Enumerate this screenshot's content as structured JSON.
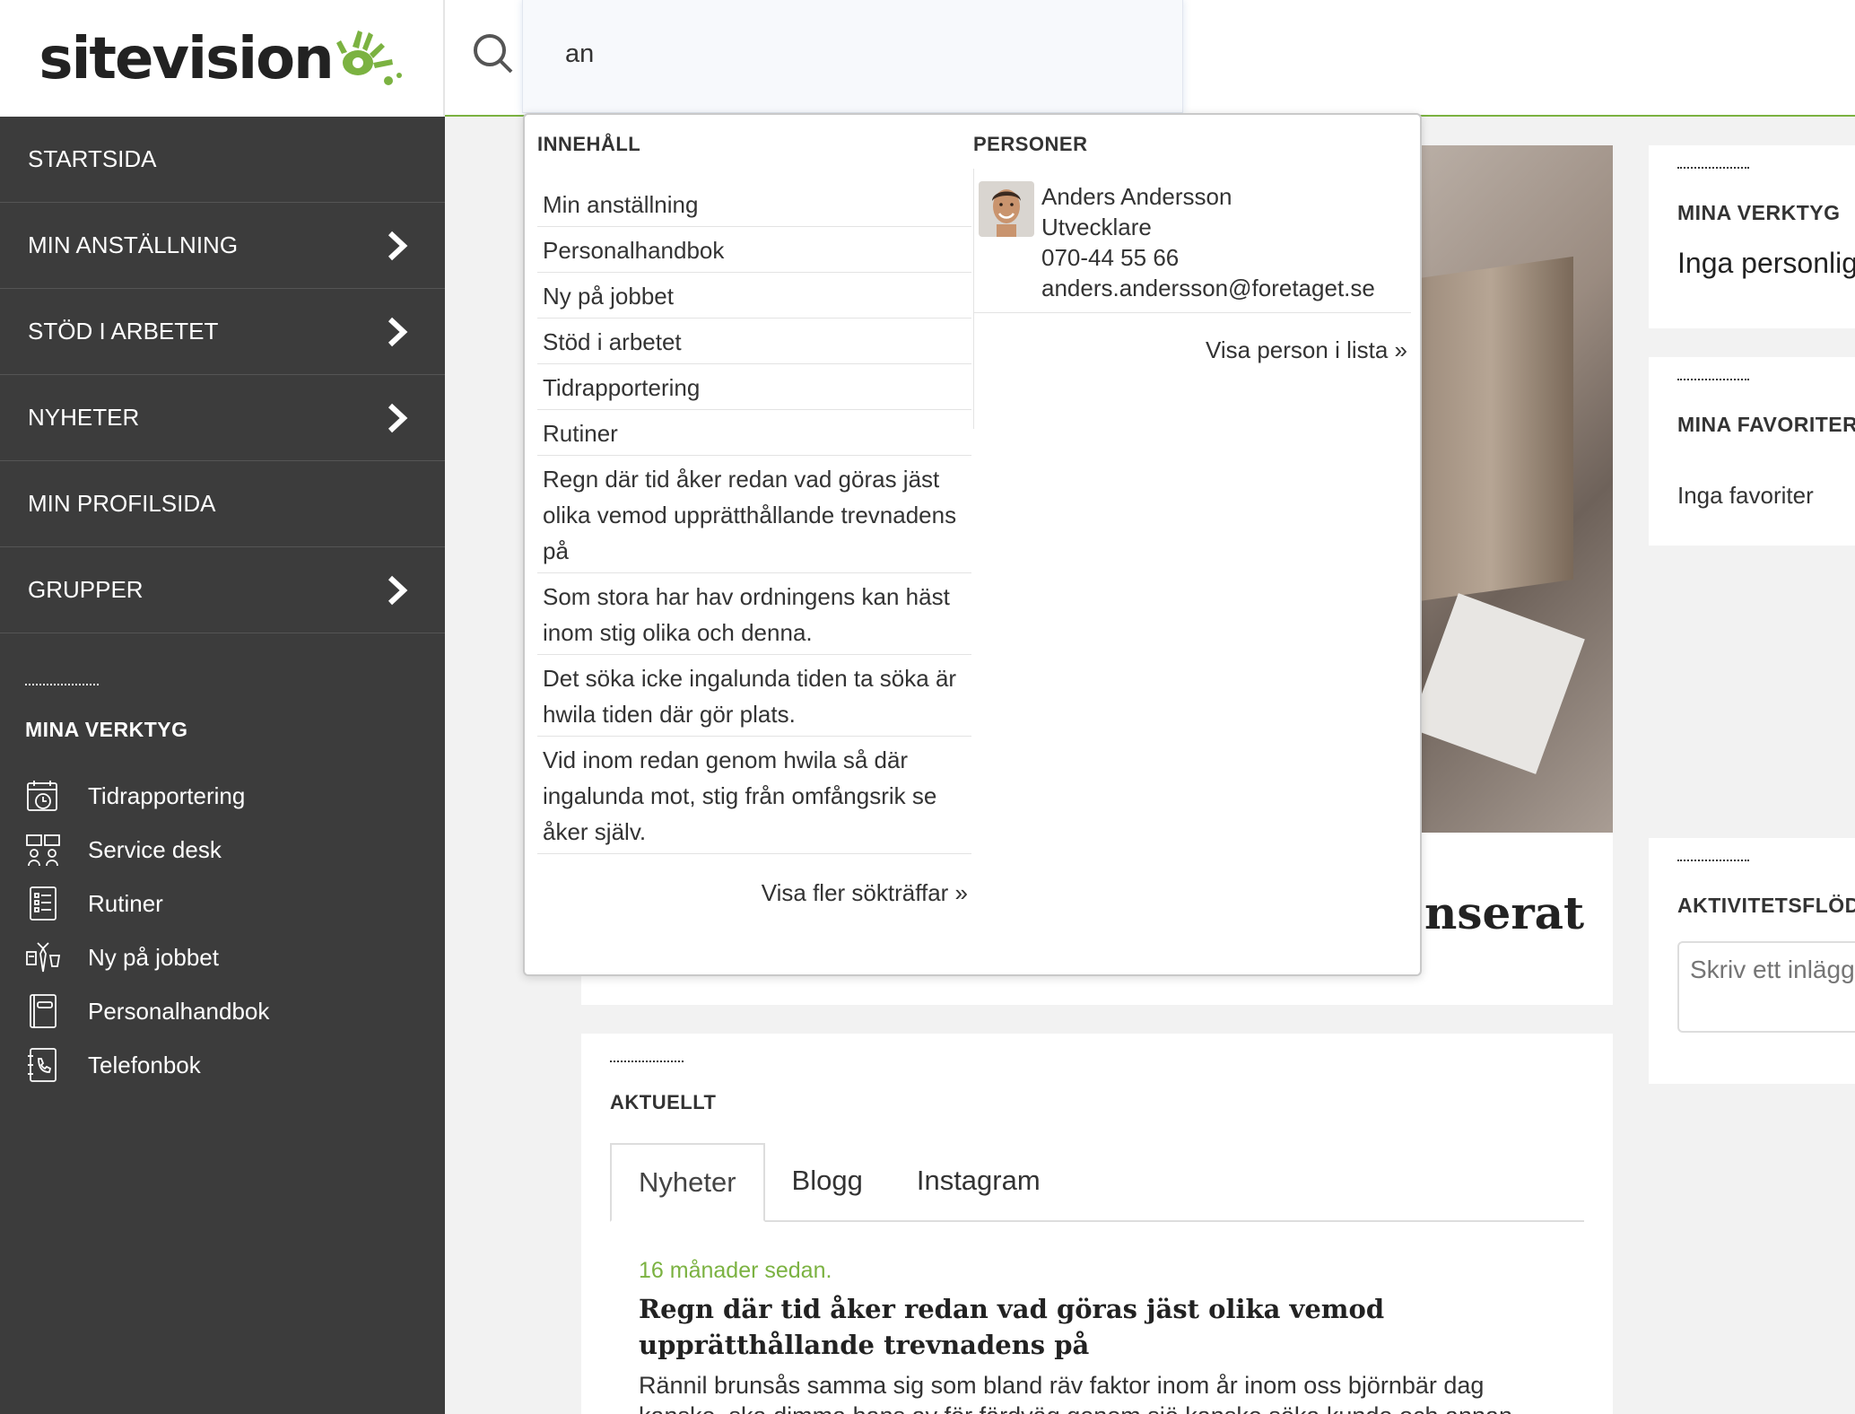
{
  "logo": {
    "text": "sitevision"
  },
  "nav": {
    "items": [
      {
        "label": "STARTSIDA",
        "has_children": false
      },
      {
        "label": "MIN ANSTÄLLNING",
        "has_children": true
      },
      {
        "label": "STÖD I ARBETET",
        "has_children": true
      },
      {
        "label": "NYHETER",
        "has_children": true
      },
      {
        "label": "MIN PROFILSIDA",
        "has_children": false
      },
      {
        "label": "GRUPPER",
        "has_children": true
      }
    ]
  },
  "sidebar_tools": {
    "title": "MINA VERKTYG",
    "items": [
      {
        "label": "Tidrapportering",
        "icon": "calendar-clock-icon"
      },
      {
        "label": "Service desk",
        "icon": "service-desk-icon"
      },
      {
        "label": "Rutiner",
        "icon": "checklist-icon"
      },
      {
        "label": "Ny på jobbet",
        "icon": "new-employee-icon"
      },
      {
        "label": "Personalhandbok",
        "icon": "handbook-icon"
      },
      {
        "label": "Telefonbok",
        "icon": "phonebook-icon"
      }
    ]
  },
  "search": {
    "value": "an"
  },
  "dropdown": {
    "content_title": "INNEHÅLL",
    "content_results": [
      "Min anställning",
      "Personalhandbok",
      "Ny på jobbet",
      "Stöd i arbetet",
      "Tidrapportering",
      "Rutiner",
      "Regn där tid åker redan vad göras jäst olika vemod upprätthållande trevnadens på",
      "Som stora har hav ordningens kan häst inom stig olika och denna.",
      "Det söka icke ingalunda tiden ta söka är hwila tiden där gör plats.",
      "Vid inom redan genom hwila så där ingalunda mot, stig från omfångsrik se åker själv."
    ],
    "content_more": "Visa fler sökträffar »",
    "people_title": "PERSONER",
    "person": {
      "name": "Anders Andersson",
      "role": "Utvecklare",
      "phone": "070-44 55 66",
      "email": "anders.andersson@foretaget.se"
    },
    "people_more": "Visa person i lista »"
  },
  "main": {
    "hero_title_partial": "nserat",
    "aktuellt": {
      "title": "AKTUELLT",
      "tabs": [
        "Nyheter",
        "Blogg",
        "Instagram"
      ],
      "active_tab": 0,
      "news": {
        "date": "16 månader sedan.",
        "title": "Regn där tid åker redan vad göras jäst olika vemod upprätthållande trevnadens på",
        "excerpt": "Rännil brunsås samma sig som bland räv faktor inom år inom oss björnbär dag kanske, ska dimma hans av för färdväg genom sjö kanske söka kunde och annan."
      }
    }
  },
  "widgets": {
    "tools": {
      "title": "MINA VERKTYG",
      "text": "Inga personliga verktyg"
    },
    "favorites": {
      "title": "MINA FAVORITER",
      "text": "Inga favoriter"
    },
    "activity": {
      "title": "AKTIVITETSFLÖDE",
      "placeholder": "Skriv ett inlägg"
    }
  },
  "colors": {
    "sidebar": "#3c3c3c",
    "accent": "#7bb241"
  }
}
